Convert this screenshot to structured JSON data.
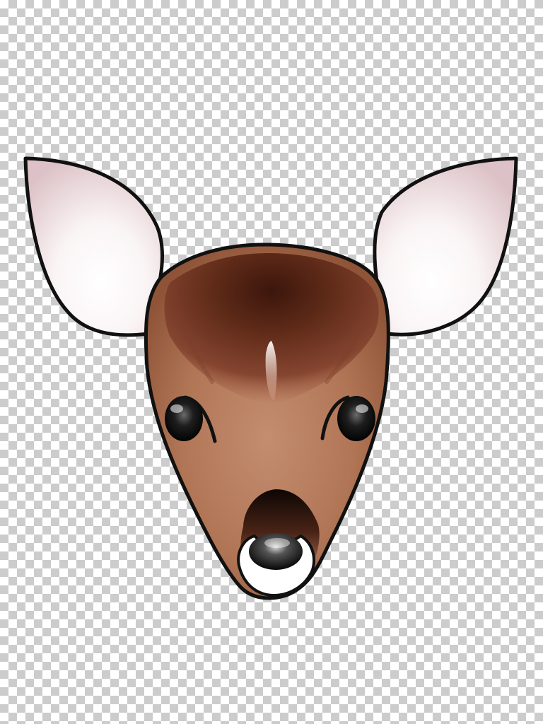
{
  "canvas": {
    "background": "transparency-checkerboard",
    "checker_light": "#ffffff",
    "checker_dark": "#cccccc"
  },
  "illustration": {
    "subject": "deer-head",
    "colors": {
      "outline": "#111111",
      "fur_dark": "#4a2012",
      "fur_mid": "#8a4a32",
      "fur_light": "#b98063",
      "ear_inner_light": "#ffffff",
      "ear_inner_tint": "#e8d2d4",
      "muzzle_white": "#ffffff",
      "eye_black": "#111111"
    }
  }
}
